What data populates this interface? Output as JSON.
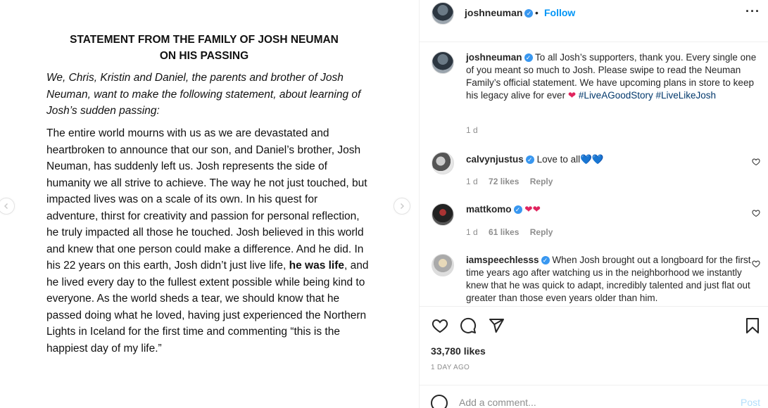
{
  "statement": {
    "title_line1": "STATEMENT FROM THE FAMILY OF JOSH NEUMAN",
    "title_line2": "ON HIS PASSING",
    "intro": "We, Chris, Kristin and Daniel, the parents and brother of Josh Neuman, want to make the following statement, about learning of Josh’s sudden passing:",
    "body_part1": "The entire world mourns with us as we are devastated and heartbroken to announce that our son, and Daniel’s brother, Josh Neuman, has suddenly left us. Josh represents the side of humanity we all strive to achieve. The way he not just touched, but impacted lives was on a scale of its own. In his quest for adventure, thirst for creativity and passion for personal reflection, he truly impacted all those he touched. Josh believed in this world and knew that one person could make a difference. And he did. In his 22 years on this earth, Josh didn’t just live life, ",
    "body_bold": "he was life",
    "body_part2": ", and he lived every day to the fullest extent possible while being kind to everyone. As the world sheds a tear, we should know that he passed doing what he loved, having just experienced the Northern Lights in Iceland for the first time and commenting “this is the happiest day of my life.”"
  },
  "header": {
    "username": "joshneuman",
    "separator": "•",
    "follow_label": "Follow",
    "more_label": "···"
  },
  "caption": {
    "username": "joshneuman",
    "text": "To all Josh’s supporters, thank you. Every single one of you meant so much to Josh. Please swipe to read the Neuman Family’s official statement. We have upcoming plans in store to keep his legacy alive for ever",
    "emoji": "❤",
    "hashtag1": "#LiveAGoodStory",
    "hashtag2": "#LiveLikeJosh",
    "time": "1 d"
  },
  "comments": [
    {
      "username": "calvynjustus",
      "text": "Love to all",
      "emoji": "💙💙",
      "time": "1 d",
      "likes": "72 likes",
      "reply": "Reply"
    },
    {
      "username": "mattkomo",
      "text": "",
      "emoji": "❤❤",
      "time": "1 d",
      "likes": "61 likes",
      "reply": "Reply"
    },
    {
      "username": "iamspeechlesss",
      "text": "When Josh brought out a longboard for the first time years ago after watching us in the neighborhood we instantly knew that he was quick to adapt, incredibly talented and just flat out greater than those even years older than him."
    }
  ],
  "footer": {
    "likes": "33,780 likes",
    "time_ago": "1 DAY AGO",
    "comment_placeholder": "Add a comment...",
    "post_label": "Post"
  },
  "colors": {
    "accent": "#0095f6",
    "verified": "#3897f0",
    "heart_red": "#e0245e"
  }
}
